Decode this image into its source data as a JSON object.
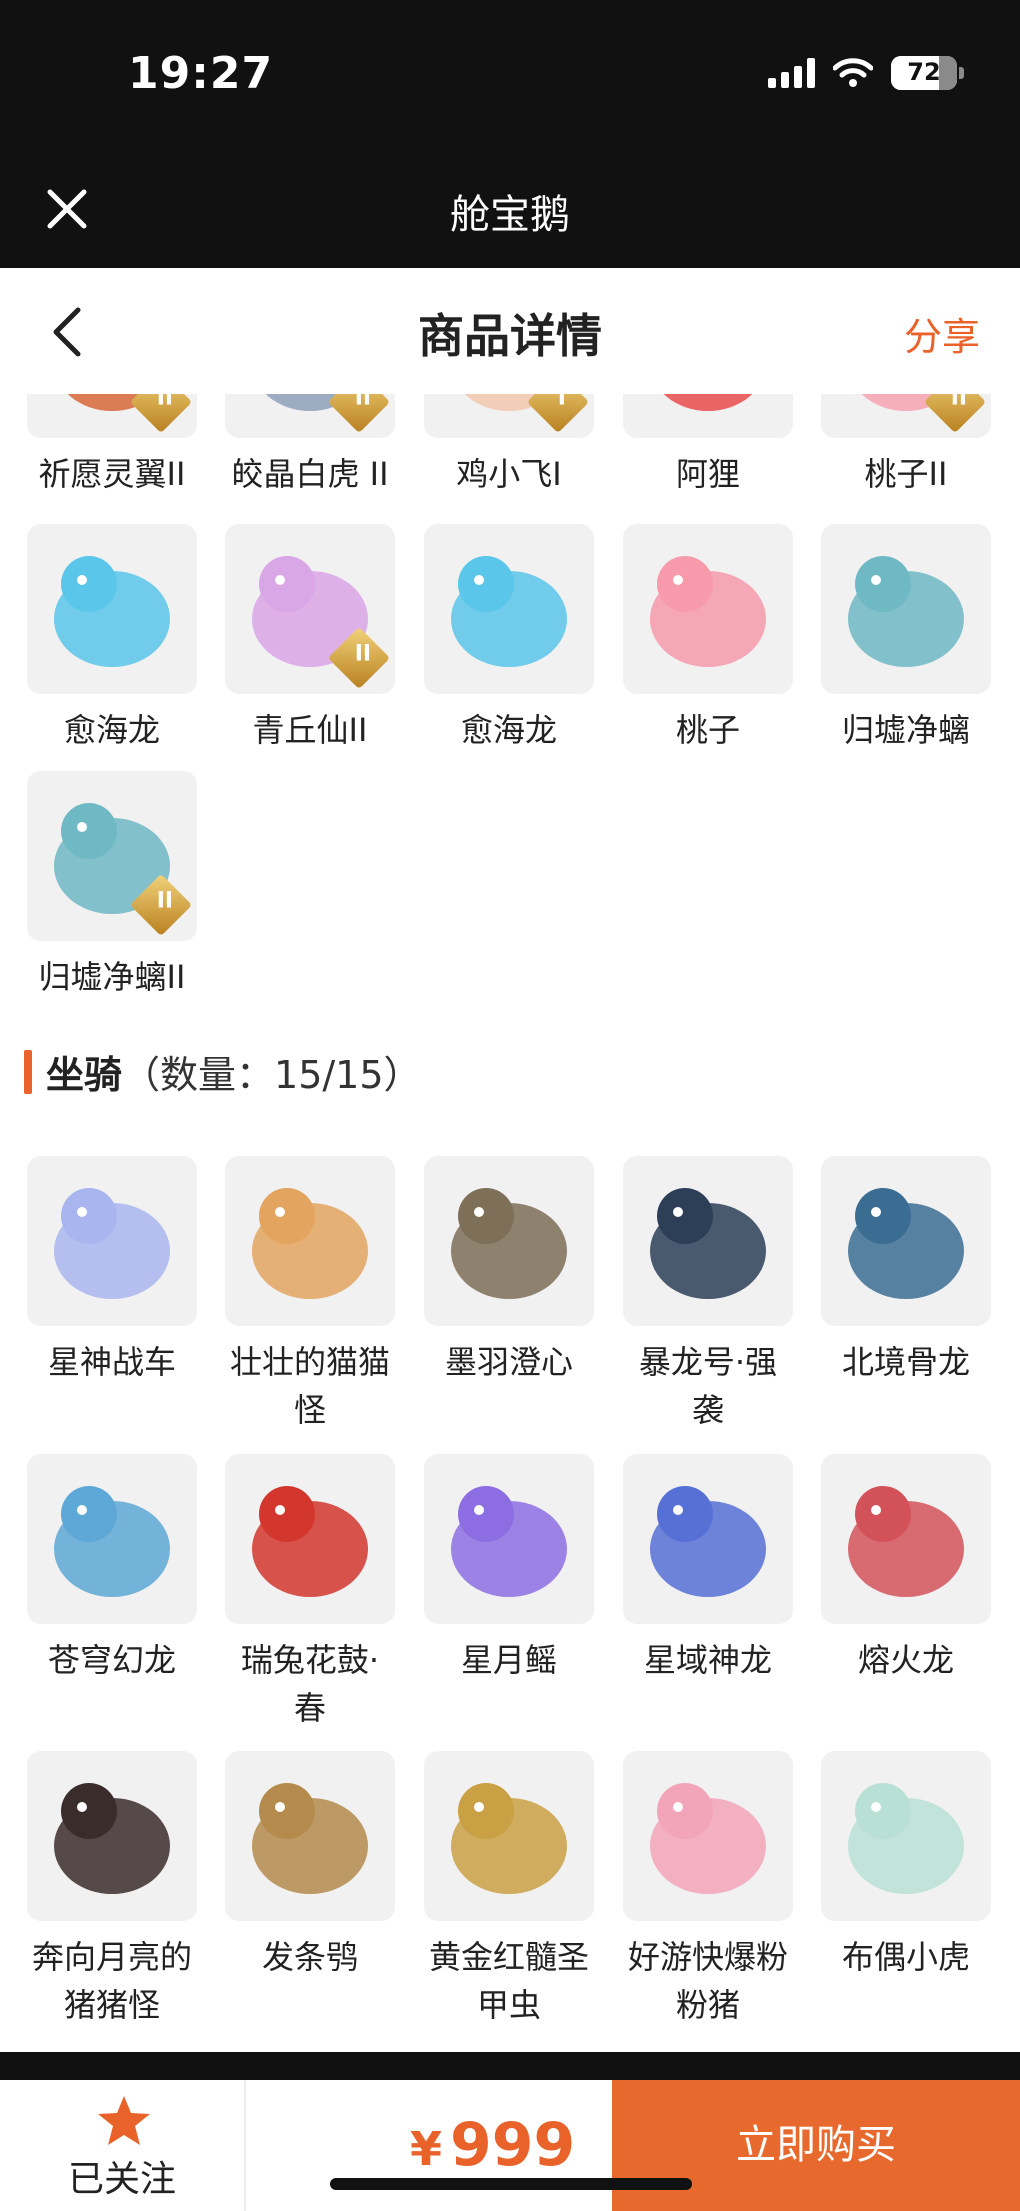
{
  "status_bar": {
    "time": "19:27",
    "battery": "72",
    "battery_level": 0.72,
    "icons": [
      "signal-icon",
      "wifi-icon",
      "battery-icon"
    ]
  },
  "app_bar": {
    "title": "舱宝鹅",
    "close_icon": "close-icon"
  },
  "nav": {
    "title": "商品详情",
    "share": "分享",
    "back_icon": "chevron-left-icon"
  },
  "skins_grid": {
    "partial_row": [
      {
        "name": "祈愿灵翼II",
        "color": "#d8673a",
        "tier": "II"
      },
      {
        "name": "皎晶白虎 II",
        "color": "#8fa0b8",
        "tier": "II"
      },
      {
        "name": "鸡小飞I",
        "color": "#f2c7ae",
        "tier": "I"
      },
      {
        "name": "阿狸",
        "color": "#e84c4c",
        "tier": ""
      },
      {
        "name": "桃子II",
        "color": "#f4a3b0",
        "tier": "II"
      }
    ],
    "rows": [
      [
        {
          "name": "愈海龙",
          "color": "#5ac6ea",
          "tier": ""
        },
        {
          "name": "青丘仙II",
          "color": "#d9a6e6",
          "tier": "II"
        },
        {
          "name": "愈海龙",
          "color": "#5ac6ea",
          "tier": ""
        },
        {
          "name": "桃子",
          "color": "#f69aac",
          "tier": ""
        },
        {
          "name": "归墟净螭",
          "color": "#6fb9c4",
          "tier": ""
        }
      ],
      [
        {
          "name": "归墟净螭II",
          "color": "#6fb9c4",
          "tier": "II"
        }
      ]
    ]
  },
  "mounts_section": {
    "title": "坐骑",
    "count": "（数量：15/15）",
    "accent": "#e8622a",
    "rows": [
      [
        {
          "name": "星神战车",
          "color": "#a9b5ee"
        },
        {
          "name": "壮壮的猫猫怪",
          "color": "#e2a45f"
        },
        {
          "name": "墨羽澄心",
          "color": "#7d6f58"
        },
        {
          "name": "暴龙号·强袭",
          "color": "#2d3f57"
        },
        {
          "name": "北境骨龙",
          "color": "#3b6d93"
        }
      ],
      [
        {
          "name": "苍穹幻龙",
          "color": "#5da8d6"
        },
        {
          "name": "瑞兔花鼓·春",
          "color": "#d2362d"
        },
        {
          "name": "星月鳐",
          "color": "#8d6ee2"
        },
        {
          "name": "星域神龙",
          "color": "#5670d6"
        },
        {
          "name": "熔火龙",
          "color": "#d3525a"
        }
      ],
      [
        {
          "name": "奔向月亮的猪猪怪",
          "color": "#3b2c2c"
        },
        {
          "name": "发条鸮",
          "color": "#b48b4c"
        },
        {
          "name": "黄金红髓圣甲虫",
          "color": "#c9a044"
        },
        {
          "name": "好游快爆粉粉猪",
          "color": "#f2a4b8"
        },
        {
          "name": "布偶小虎",
          "color": "#b9e0d5"
        }
      ]
    ]
  },
  "bottom_bar": {
    "follow_label": "已关注",
    "follow_icon": "star-icon",
    "currency": "¥",
    "price": "999",
    "buy_label": "立即购买",
    "accent": "#e8692e"
  }
}
